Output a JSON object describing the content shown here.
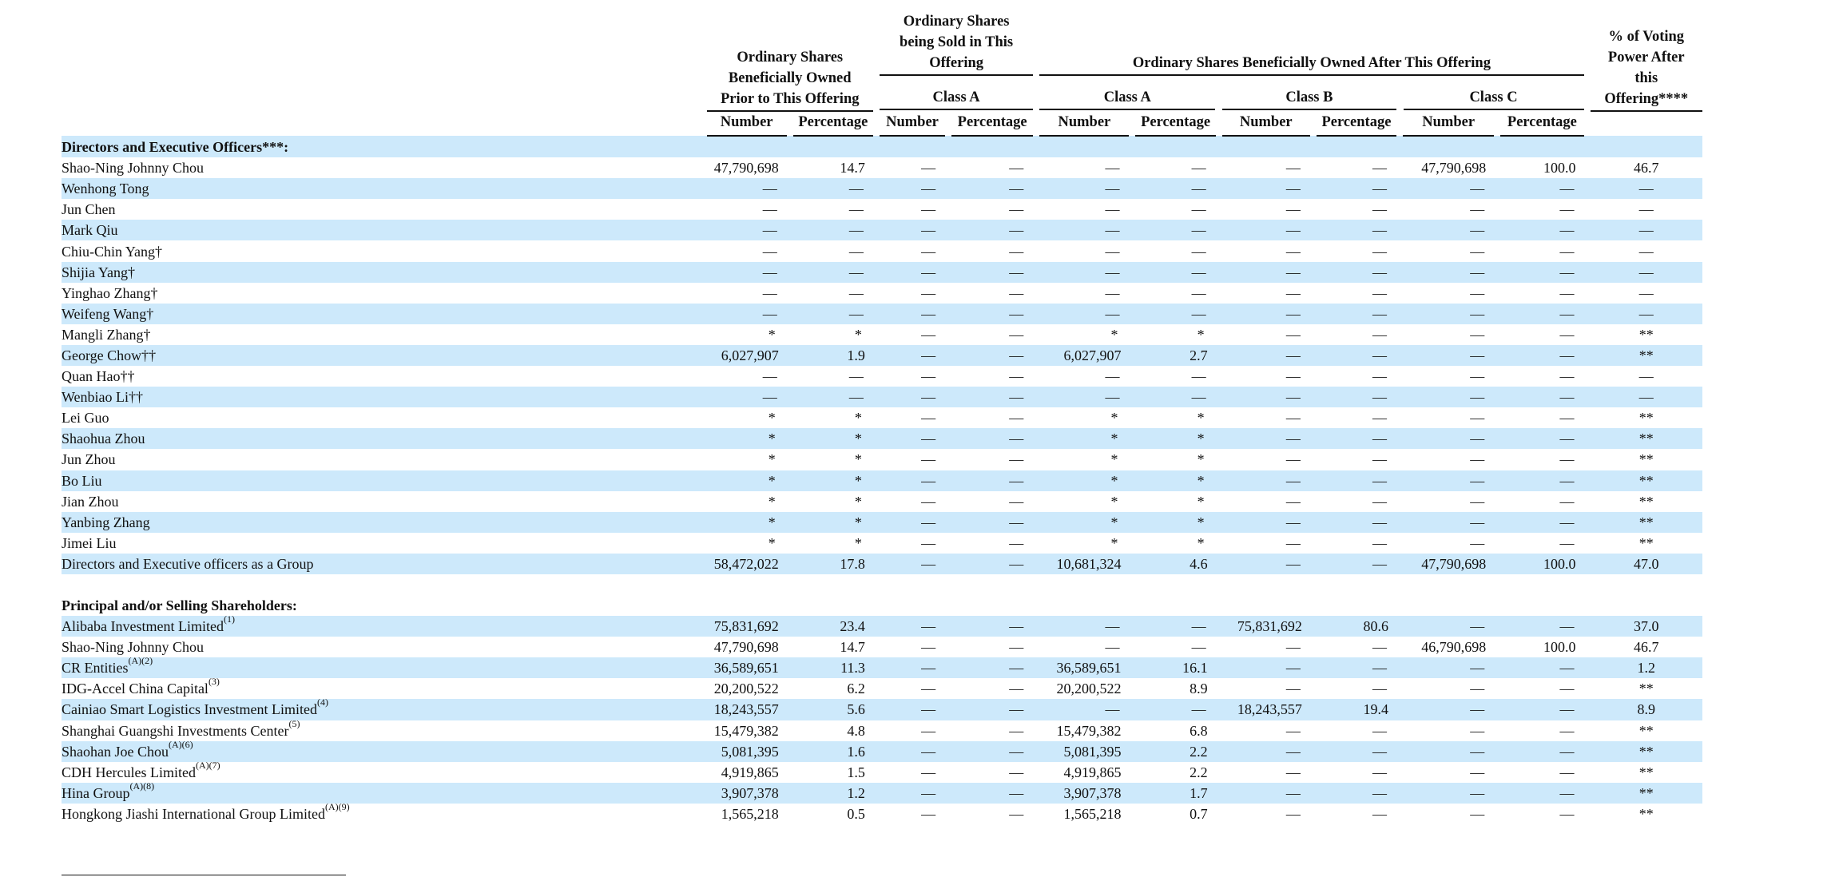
{
  "headers": {
    "prior": "Ordinary Shares Beneficially Owned Prior to This Offering",
    "sold": "Ordinary Shares being Sold in This Offering",
    "after": "Ordinary Shares Beneficially Owned After This Offering",
    "voting": "% of Voting Power After this Offering****",
    "class_a": "Class A",
    "class_b": "Class B",
    "class_c": "Class C",
    "number": "Number",
    "percentage": "Percentage"
  },
  "sections": [
    {
      "title": "Directors and Executive Officers***:",
      "rows": [
        {
          "name": "Shao-Ning Johnny Chou",
          "sup": "",
          "cells": [
            "47,790,698",
            "14.7",
            "—",
            "—",
            "—",
            "—",
            "—",
            "—",
            "47,790,698",
            "100.0",
            "46.7"
          ]
        },
        {
          "name": "Wenhong Tong",
          "sup": "",
          "cells": [
            "—",
            "—",
            "—",
            "—",
            "—",
            "—",
            "—",
            "—",
            "—",
            "—",
            "—"
          ]
        },
        {
          "name": "Jun Chen",
          "sup": "",
          "cells": [
            "—",
            "—",
            "—",
            "—",
            "—",
            "—",
            "—",
            "—",
            "—",
            "—",
            "—"
          ]
        },
        {
          "name": "Mark Qiu",
          "sup": "",
          "cells": [
            "—",
            "—",
            "—",
            "—",
            "—",
            "—",
            "—",
            "—",
            "—",
            "—",
            "—"
          ]
        },
        {
          "name": "Chiu-Chin Yang†",
          "sup": "",
          "cells": [
            "—",
            "—",
            "—",
            "—",
            "—",
            "—",
            "—",
            "—",
            "—",
            "—",
            "—"
          ]
        },
        {
          "name": "Shijia Yang†",
          "sup": "",
          "cells": [
            "—",
            "—",
            "—",
            "—",
            "—",
            "—",
            "—",
            "—",
            "—",
            "—",
            "—"
          ]
        },
        {
          "name": "Yinghao Zhang†",
          "sup": "",
          "cells": [
            "—",
            "—",
            "—",
            "—",
            "—",
            "—",
            "—",
            "—",
            "—",
            "—",
            "—"
          ]
        },
        {
          "name": "Weifeng Wang†",
          "sup": "",
          "cells": [
            "—",
            "—",
            "—",
            "—",
            "—",
            "—",
            "—",
            "—",
            "—",
            "—",
            "—"
          ]
        },
        {
          "name": "Mangli Zhang†",
          "sup": "",
          "cells": [
            "*",
            "*",
            "—",
            "—",
            "*",
            "*",
            "—",
            "—",
            "—",
            "—",
            "**"
          ]
        },
        {
          "name": "George Chow††",
          "sup": "",
          "cells": [
            "6,027,907",
            "1.9",
            "—",
            "—",
            "6,027,907",
            "2.7",
            "—",
            "—",
            "—",
            "—",
            "**"
          ]
        },
        {
          "name": "Quan Hao††",
          "sup": "",
          "cells": [
            "—",
            "—",
            "—",
            "—",
            "—",
            "—",
            "—",
            "—",
            "—",
            "—",
            "—"
          ]
        },
        {
          "name": "Wenbiao Li††",
          "sup": "",
          "cells": [
            "—",
            "—",
            "—",
            "—",
            "—",
            "—",
            "—",
            "—",
            "—",
            "—",
            "—"
          ]
        },
        {
          "name": "Lei Guo",
          "sup": "",
          "cells": [
            "*",
            "*",
            "—",
            "—",
            "*",
            "*",
            "—",
            "—",
            "—",
            "—",
            "**"
          ]
        },
        {
          "name": "Shaohua Zhou",
          "sup": "",
          "cells": [
            "*",
            "*",
            "—",
            "—",
            "*",
            "*",
            "—",
            "—",
            "—",
            "—",
            "**"
          ]
        },
        {
          "name": "Jun Zhou",
          "sup": "",
          "cells": [
            "*",
            "*",
            "—",
            "—",
            "*",
            "*",
            "—",
            "—",
            "—",
            "—",
            "**"
          ]
        },
        {
          "name": "Bo Liu",
          "sup": "",
          "cells": [
            "*",
            "*",
            "—",
            "—",
            "*",
            "*",
            "—",
            "—",
            "—",
            "—",
            "**"
          ]
        },
        {
          "name": "Jian Zhou",
          "sup": "",
          "cells": [
            "*",
            "*",
            "—",
            "—",
            "*",
            "*",
            "—",
            "—",
            "—",
            "—",
            "**"
          ]
        },
        {
          "name": "Yanbing Zhang",
          "sup": "",
          "cells": [
            "*",
            "*",
            "—",
            "—",
            "*",
            "*",
            "—",
            "—",
            "—",
            "—",
            "**"
          ]
        },
        {
          "name": "Jimei Liu",
          "sup": "",
          "cells": [
            "*",
            "*",
            "—",
            "—",
            "*",
            "*",
            "—",
            "—",
            "—",
            "—",
            "**"
          ]
        },
        {
          "name": "Directors and Executive officers as a Group",
          "sup": "",
          "cells": [
            "58,472,022",
            "17.8",
            "—",
            "—",
            "10,681,324",
            "4.6",
            "—",
            "—",
            "47,790,698",
            "100.0",
            "47.0"
          ]
        }
      ]
    },
    {
      "title": "Principal and/or Selling Shareholders:",
      "rows": [
        {
          "name": "Alibaba Investment Limited",
          "sup": "(1)",
          "cells": [
            "75,831,692",
            "23.4",
            "—",
            "—",
            "—",
            "—",
            "75,831,692",
            "80.6",
            "—",
            "—",
            "37.0"
          ]
        },
        {
          "name": "Shao-Ning Johnny Chou",
          "sup": "",
          "cells": [
            "47,790,698",
            "14.7",
            "—",
            "—",
            "—",
            "—",
            "—",
            "—",
            "46,790,698",
            "100.0",
            "46.7"
          ]
        },
        {
          "name": "CR Entities",
          "sup": "(A)(2)",
          "cells": [
            "36,589,651",
            "11.3",
            "—",
            "—",
            "36,589,651",
            "16.1",
            "—",
            "—",
            "—",
            "—",
            "1.2"
          ]
        },
        {
          "name": "IDG-Accel China Capital",
          "sup": "(3)",
          "cells": [
            "20,200,522",
            "6.2",
            "—",
            "—",
            "20,200,522",
            "8.9",
            "—",
            "—",
            "—",
            "—",
            "**"
          ]
        },
        {
          "name": "Cainiao Smart Logistics Investment Limited",
          "sup": "(4)",
          "cells": [
            "18,243,557",
            "5.6",
            "—",
            "—",
            "—",
            "—",
            "18,243,557",
            "19.4",
            "—",
            "—",
            "8.9"
          ]
        },
        {
          "name": "Shanghai Guangshi Investments Center",
          "sup": "(5)",
          "cells": [
            "15,479,382",
            "4.8",
            "—",
            "—",
            "15,479,382",
            "6.8",
            "—",
            "—",
            "—",
            "—",
            "**"
          ]
        },
        {
          "name": "Shaohan Joe Chou",
          "sup": "(A)(6)",
          "cells": [
            "5,081,395",
            "1.6",
            "—",
            "—",
            "5,081,395",
            "2.2",
            "—",
            "—",
            "—",
            "—",
            "**"
          ]
        },
        {
          "name": "CDH Hercules Limited",
          "sup": "(A)(7)",
          "cells": [
            "4,919,865",
            "1.5",
            "—",
            "—",
            "4,919,865",
            "2.2",
            "—",
            "—",
            "—",
            "—",
            "**"
          ]
        },
        {
          "name": "Hina Group",
          "sup": "(A)(8)",
          "cells": [
            "3,907,378",
            "1.2",
            "—",
            "—",
            "3,907,378",
            "1.7",
            "—",
            "—",
            "—",
            "—",
            "**"
          ]
        },
        {
          "name": "Hongkong Jiashi International Group Limited",
          "sup": "(A)(9)",
          "cells": [
            "1,565,218",
            "0.5",
            "—",
            "—",
            "1,565,218",
            "0.7",
            "—",
            "—",
            "—",
            "—",
            "**"
          ]
        }
      ]
    }
  ]
}
